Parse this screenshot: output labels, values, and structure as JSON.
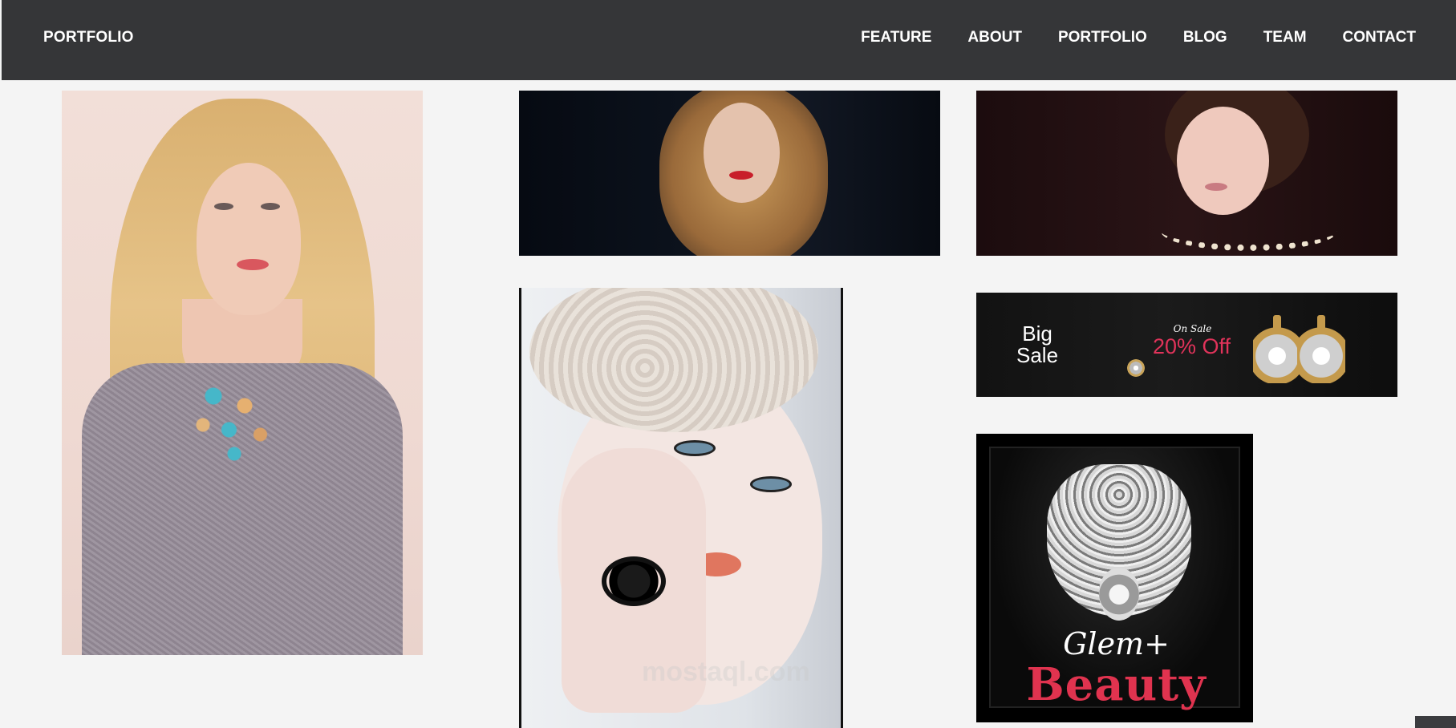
{
  "navbar": {
    "brand": "PORTFOLIO",
    "items": [
      {
        "label": "FEATURE"
      },
      {
        "label": "ABOUT"
      },
      {
        "label": "PORTFOLIO"
      },
      {
        "label": "BLOG"
      },
      {
        "label": "TEAM"
      },
      {
        "label": "CONTACT"
      }
    ]
  },
  "gallery": {
    "sale_banner": {
      "line1": "Big",
      "line2": "Sale",
      "tag": "On Sale",
      "discount": "20% Off"
    },
    "beauty_poster": {
      "brand": "Glem+",
      "tagline": "Beauty"
    },
    "watermark": "mostaql.com"
  },
  "colors": {
    "navbar_bg": "#353638",
    "page_bg": "#f4f4f4",
    "accent_pink": "#e0334f"
  }
}
